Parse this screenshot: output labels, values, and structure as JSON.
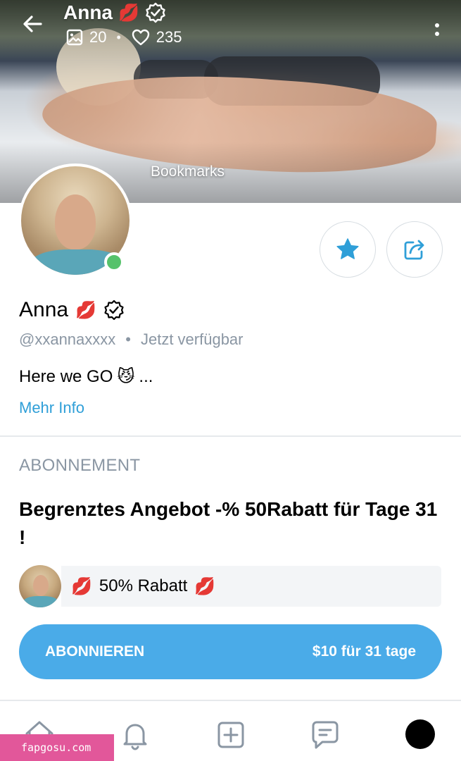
{
  "header": {
    "name": "Anna",
    "name_emoji": "💋",
    "media_count": "20",
    "likes_count": "235",
    "icons": [
      "back-arrow-icon",
      "image-icon",
      "heart-icon",
      "more-vertical-icon",
      "verified-icon"
    ]
  },
  "cover": {
    "bookmarks_label": "Bookmarks"
  },
  "profile": {
    "name": "Anna",
    "name_emoji": "💋",
    "handle": "@xxannaxxxx",
    "separator": "•",
    "status": "Jetzt verfügbar",
    "bio": "Here we GO",
    "bio_emoji": "😼",
    "bio_ellipsis": "...",
    "more_info": "Mehr Info",
    "online_color": "#56c26b"
  },
  "subscription": {
    "section_title": "ABONNEMENT",
    "offer_title": "Begrenztes Angebot -% 50Rabatt für Tage 31 !",
    "promo_emoji": "💋",
    "promo_text": "50% Rabatt",
    "button_label": "ABONNIEREN",
    "button_price": "$10 für 31 tage",
    "button_color": "#4aabe8"
  },
  "bottom_nav": {
    "items": [
      "home-icon",
      "bell-icon",
      "plus-square-icon",
      "chat-icon",
      "profile-avatar"
    ]
  },
  "watermark": {
    "text": "fapgosu.com"
  },
  "colors": {
    "accent": "#2f9fd8",
    "muted_text": "#8a96a3"
  }
}
